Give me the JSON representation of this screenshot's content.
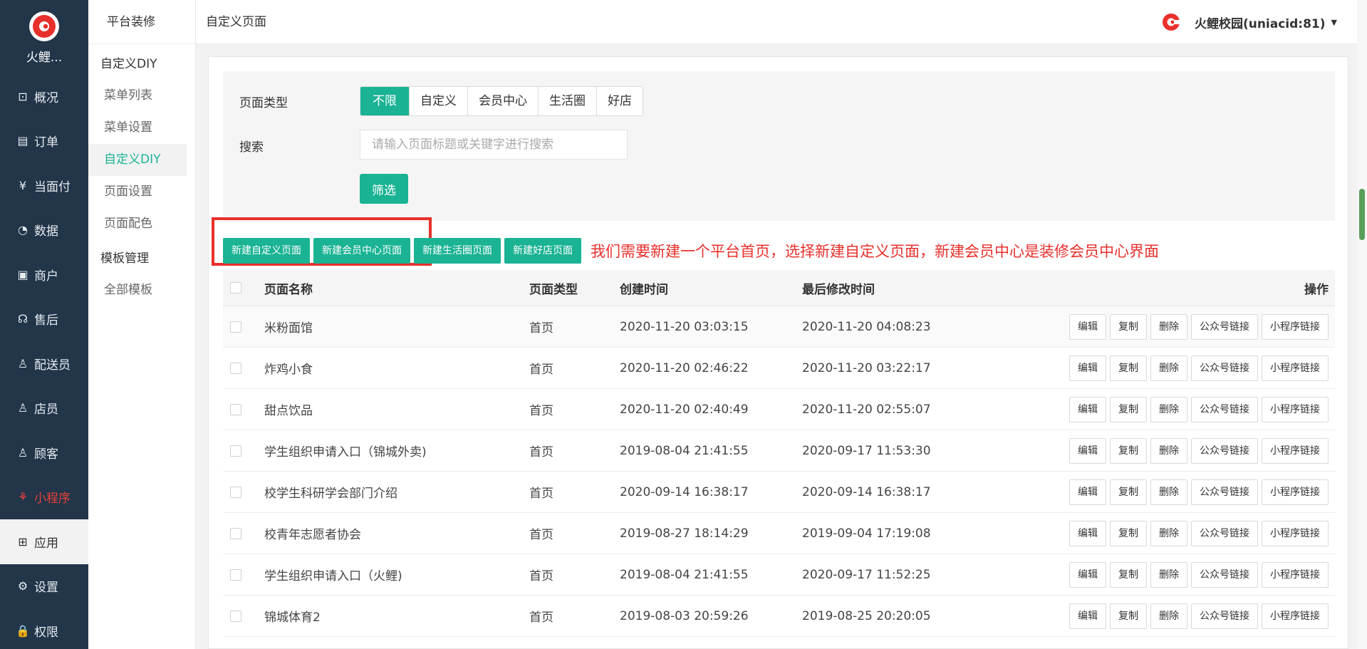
{
  "brand": {
    "name": "火鲤..."
  },
  "nav": [
    {
      "icon": "overview-icon",
      "glyph": "⊡",
      "label": "概况"
    },
    {
      "icon": "order-icon",
      "glyph": "▤",
      "label": "订单"
    },
    {
      "icon": "yuan-icon",
      "glyph": "¥",
      "label": "当面付"
    },
    {
      "icon": "chart-icon",
      "glyph": "◔",
      "label": "数据"
    },
    {
      "icon": "shop-icon",
      "glyph": "▣",
      "label": "商户"
    },
    {
      "icon": "aftersale-icon",
      "glyph": "☊",
      "label": "售后"
    },
    {
      "icon": "courier-icon",
      "glyph": "♙",
      "label": "配送员"
    },
    {
      "icon": "clerk-icon",
      "glyph": "♙",
      "label": "店员"
    },
    {
      "icon": "customer-icon",
      "glyph": "♙",
      "label": "顾客"
    },
    {
      "icon": "miniprogram-icon",
      "glyph": "⚘",
      "label": "小程序"
    },
    {
      "icon": "apps-icon",
      "glyph": "⊞",
      "label": "应用"
    },
    {
      "icon": "settings-icon",
      "glyph": "⚙",
      "label": "设置"
    },
    {
      "icon": "lock-icon",
      "glyph": "🔒",
      "label": "权限"
    }
  ],
  "subnav": {
    "title": "平台装修",
    "group1": "自定义DIY",
    "items1": [
      "菜单列表",
      "菜单设置",
      "自定义DIY",
      "页面设置",
      "页面配色"
    ],
    "group2": "模板管理",
    "items2": [
      "全部模板"
    ]
  },
  "header": {
    "title": "自定义页面",
    "user": "火鲤校园(uniacid:81)"
  },
  "filter": {
    "type_label": "页面类型",
    "types": [
      "不限",
      "自定义",
      "会员中心",
      "生活圈",
      "好店"
    ],
    "search_label": "搜索",
    "search_placeholder": "请输入页面标题或关键字进行搜索",
    "filter_button": "筛选"
  },
  "actions": {
    "new_custom": "新建自定义页面",
    "new_member": "新建会员中心页面",
    "new_life": "新建生活圈页面",
    "new_shop": "新建好店页面",
    "annotation": "我们需要新建一个平台首页，选择新建自定义页面，新建会员中心是装修会员中心界面"
  },
  "table": {
    "headers": {
      "name": "页面名称",
      "type": "页面类型",
      "created": "创建时间",
      "modified": "最后修改时间",
      "ops": "操作"
    },
    "op_labels": {
      "edit": "编辑",
      "copy": "复制",
      "delete": "删除",
      "mp_link": "公众号链接",
      "mini_link": "小程序链接"
    },
    "rows": [
      {
        "name": "米粉面馆",
        "type": "首页",
        "created": "2020-11-20 03:03:15",
        "modified": "2020-11-20 04:08:23"
      },
      {
        "name": "炸鸡小食",
        "type": "首页",
        "created": "2020-11-20 02:46:22",
        "modified": "2020-11-20 03:22:17"
      },
      {
        "name": "甜点饮品",
        "type": "首页",
        "created": "2020-11-20 02:40:49",
        "modified": "2020-11-20 02:55:07"
      },
      {
        "name": "学生组织申请入口（锦城外卖)",
        "type": "首页",
        "created": "2019-08-04 21:41:55",
        "modified": "2020-09-17 11:53:30"
      },
      {
        "name": "校学生科研学会部门介绍",
        "type": "首页",
        "created": "2020-09-14 16:38:17",
        "modified": "2020-09-14 16:38:17"
      },
      {
        "name": "校青年志愿者协会",
        "type": "首页",
        "created": "2019-08-27 18:14:29",
        "modified": "2019-09-04 17:19:08"
      },
      {
        "name": "学生组织申请入口（火鲤)",
        "type": "首页",
        "created": "2019-08-04 21:41:55",
        "modified": "2020-09-17 11:52:25"
      },
      {
        "name": "锦城体育2",
        "type": "首页",
        "created": "2019-08-03 20:59:26",
        "modified": "2019-08-25 20:20:05"
      }
    ]
  },
  "colors": {
    "accent": "#1ab394",
    "sidebar": "#223549",
    "annotation": "#e8302c"
  }
}
